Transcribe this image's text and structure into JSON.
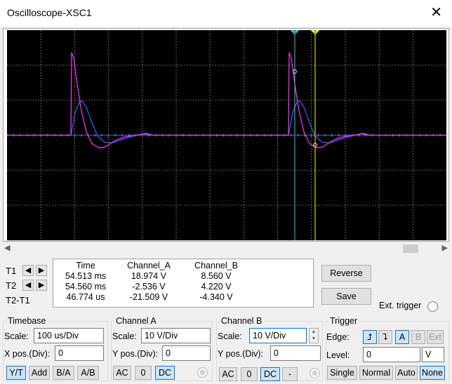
{
  "window": {
    "title": "Oscilloscope-XSC1",
    "close_glyph": "✕"
  },
  "scope": {
    "background": "#000000",
    "grid_color": "#808080",
    "channel_a_color": "#ff33ff",
    "channel_b_color": "#3366ff",
    "cursor1_color": "#33cccc",
    "cursor2_color": "#ffff00",
    "cursor1_label": "1",
    "cursor2_label": "2"
  },
  "cursors": {
    "t1_label": "T1",
    "t2_label": "T2",
    "diff_label": "T2-T1",
    "left_arrow": "◀",
    "right_arrow": "▶"
  },
  "readout": {
    "headers": [
      "Time",
      "Channel_A",
      "Channel_B"
    ],
    "rows": [
      [
        "54.513 ms",
        "18.974 V",
        "8.560 V"
      ],
      [
        "54.560 ms",
        "-2.536 V",
        "4.220 V"
      ],
      [
        "46.774 us",
        "-21.509 V",
        "-4.340 V"
      ]
    ]
  },
  "buttons": {
    "reverse": "Reverse",
    "save": "Save",
    "ext_trigger": "Ext. trigger"
  },
  "timebase": {
    "title": "Timebase",
    "scale_label": "Scale:",
    "scale_value": "100 us/Div",
    "xpos_label": "X pos.(Div):",
    "xpos_value": "0",
    "modes": [
      "Y/T",
      "Add",
      "B/A",
      "A/B"
    ],
    "selected_mode": "Y/T"
  },
  "channel_a": {
    "title": "Channel A",
    "scale_label": "Scale:",
    "scale_value": "10  V/Div",
    "ypos_label": "Y pos.(Div):",
    "ypos_value": "0",
    "coupling": [
      "AC",
      "0",
      "DC"
    ],
    "selected": "DC"
  },
  "channel_b": {
    "title": "Channel B",
    "scale_label": "Scale:",
    "scale_value": "10  V/Div",
    "ypos_label": "Y pos.(Div):",
    "ypos_value": "0",
    "coupling": [
      "AC",
      "0",
      "DC",
      "-"
    ],
    "selected": "DC"
  },
  "trigger": {
    "title": "Trigger",
    "edge_label": "Edge:",
    "edge_rising": "⮥",
    "edge_falling": "⮧",
    "sources": [
      "A",
      "B",
      "Ext"
    ],
    "selected_source": "A",
    "level_label": "Level:",
    "level_value": "0",
    "level_unit": "V",
    "modes": [
      "Single",
      "Normal",
      "Auto",
      "None"
    ],
    "selected_mode": "None"
  },
  "scrollbar": {
    "left": "◀",
    "right": "▶"
  }
}
